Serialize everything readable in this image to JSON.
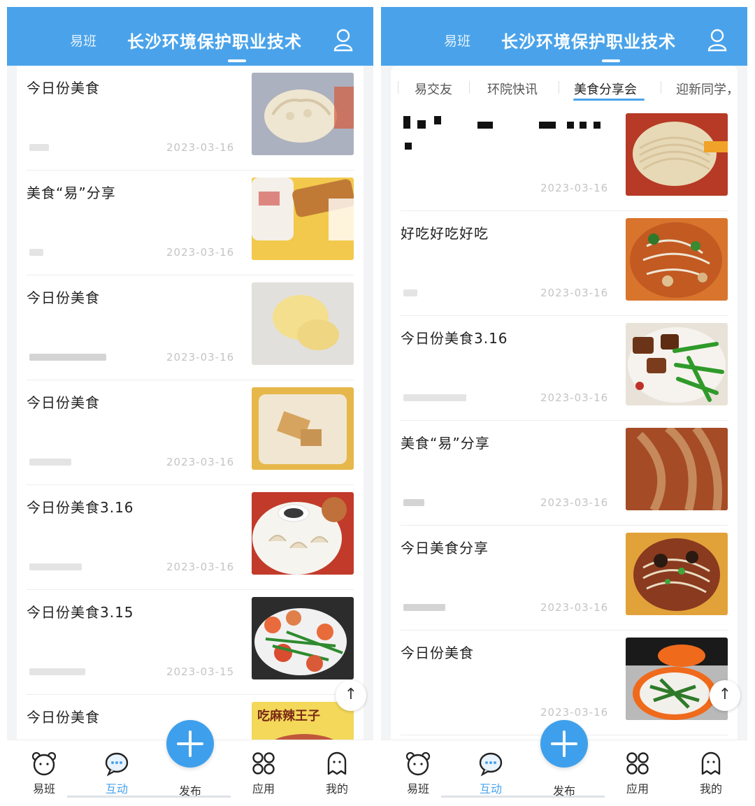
{
  "header": {
    "tab_left": "易班",
    "tab_main": "长沙环境保护职业技术"
  },
  "subtabs": [
    "易交友",
    "环院快讯",
    "美食分享会",
    "迎新同学，"
  ],
  "left_list": [
    {
      "title": "今日份美食",
      "date": "2023-03-16"
    },
    {
      "title": "美食“易”分享",
      "date": "2023-03-16"
    },
    {
      "title": "今日份美食",
      "date": "2023-03-16"
    },
    {
      "title": "今日份美食",
      "date": "2023-03-16"
    },
    {
      "title": "今日份美食3.16",
      "date": "2023-03-16"
    },
    {
      "title": "今日份美食3.15",
      "date": "2023-03-15"
    },
    {
      "title": "今日份美食",
      "date": ""
    }
  ],
  "right_list": [
    {
      "title": "",
      "date": "2023-03-16"
    },
    {
      "title": "好吃好吃好吃",
      "date": "2023-03-16"
    },
    {
      "title": "今日份美食3.16",
      "date": "2023-03-16"
    },
    {
      "title": "美食“易”分享",
      "date": "2023-03-16"
    },
    {
      "title": "今日美食分享",
      "date": "2023-03-16"
    },
    {
      "title": "今日份美食",
      "date": "2023-03-16"
    }
  ],
  "thumb_banner_text": "吃麻辣王子",
  "nav": {
    "yiban": "易班",
    "hudong": "互动",
    "fabu": "发布",
    "yingyong": "应用",
    "wode": "我的"
  },
  "back_to_top_glyph": "↑",
  "colors": {
    "accent": "#4aa3ea",
    "fab": "#3ea0ec"
  }
}
